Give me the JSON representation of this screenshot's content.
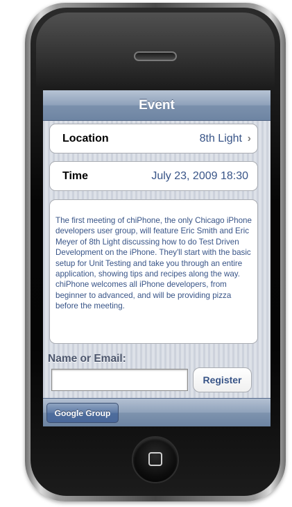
{
  "navbar": {
    "title": "Event"
  },
  "details": {
    "location": {
      "label": "Location",
      "value": "8th Light",
      "chevron": "›"
    },
    "time": {
      "label": "Time",
      "value": "July 23, 2009 18:30"
    }
  },
  "description": "The first meeting of chiPhone, the only Chicago iPhone developers user group, will feature Eric Smith and Eric Meyer of 8th Light discussing how to do Test Driven Development on the iPhone. They'll start with the basic setup for Unit Testing and take you through an entire application, showing tips and recipes along the way. chiPhone welcomes all iPhone developers, from beginner to advanced, and will be providing pizza before the meeting.",
  "registration": {
    "label": "Name or Email:",
    "input_value": "",
    "button_label": "Register"
  },
  "toolbar": {
    "button_label": "Google Group"
  },
  "device": {
    "icons": [
      "speaker-grille-icon",
      "home-button-icon"
    ]
  },
  "colors": {
    "accent_text": "#385487",
    "navbar": "#8ea1ba",
    "background": "#d6dae3"
  }
}
